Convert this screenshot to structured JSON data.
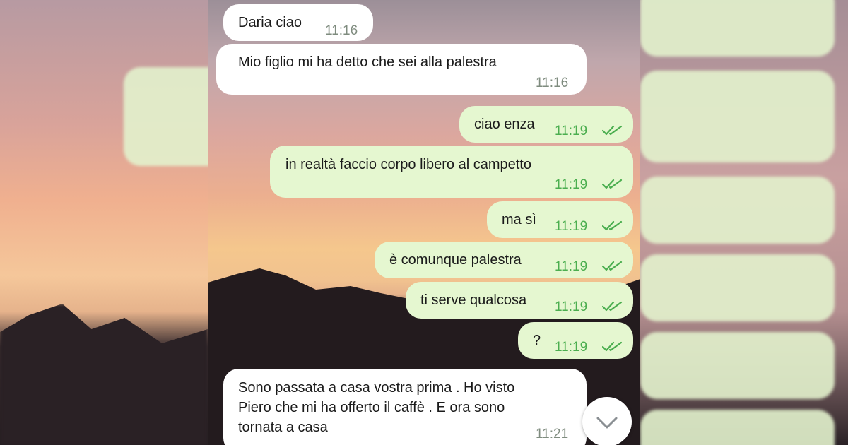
{
  "messages": [
    {
      "direction": "in",
      "text": "Daria ciao",
      "time": "11:16"
    },
    {
      "direction": "in",
      "text": "Mio figlio mi ha detto che sei alla palestra",
      "time": "11:16"
    },
    {
      "direction": "out",
      "text": "ciao enza",
      "time": "11:19",
      "status": "read"
    },
    {
      "direction": "out",
      "text": "in realtà faccio corpo libero al campetto",
      "time": "11:19",
      "status": "read"
    },
    {
      "direction": "out",
      "text": "ma sì",
      "time": "11:19",
      "status": "read"
    },
    {
      "direction": "out",
      "text": "è comunque palestra",
      "time": "11:19",
      "status": "read"
    },
    {
      "direction": "out",
      "text": "ti serve qualcosa",
      "time": "11:19",
      "status": "read"
    },
    {
      "direction": "out",
      "text": "?",
      "time": "11:19",
      "status": "read"
    },
    {
      "direction": "in",
      "lines": [
        "Sono passata a casa vostra prima . Ho visto",
        "Piero che mi ha offerto il caffè . E ora sono",
        "tornata a casa"
      ],
      "time": "11:21"
    }
  ],
  "icons": {
    "read_receipt": "double-check-icon",
    "scroll_down": "chevron-down-icon"
  },
  "colors": {
    "incoming_bubble": "#ffffff",
    "outgoing_bubble": "#e5f7d0",
    "outgoing_time": "#4bae4f",
    "incoming_time": "#7f8c7f"
  }
}
